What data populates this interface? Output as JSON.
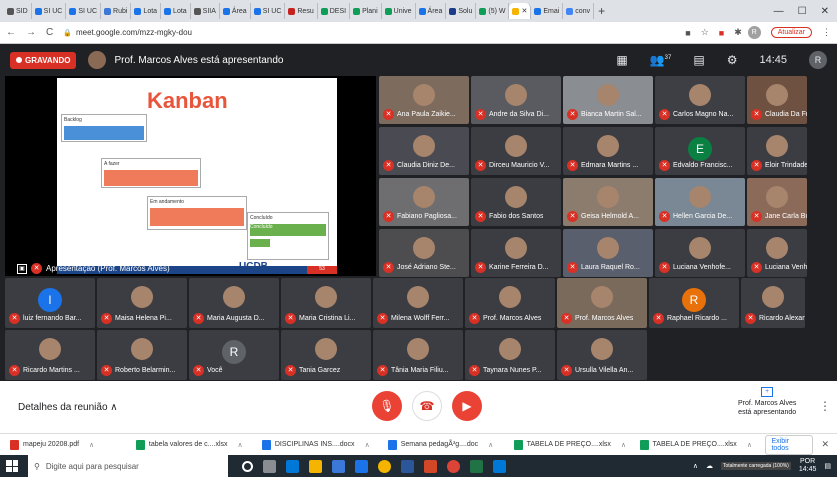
{
  "browser": {
    "tabs": [
      {
        "label": "SID",
        "color": "#555555"
      },
      {
        "label": "SI UC",
        "color": "#1a73e8"
      },
      {
        "label": "SI UC",
        "color": "#1a73e8"
      },
      {
        "label": "Rubi",
        "color": "#3c78d8"
      },
      {
        "label": "Lota",
        "color": "#1a73e8"
      },
      {
        "label": "Lota",
        "color": "#1a73e8"
      },
      {
        "label": "SIIA",
        "color": "#555555"
      },
      {
        "label": "Área",
        "color": "#1a73e8"
      },
      {
        "label": "SI UC",
        "color": "#1a73e8"
      },
      {
        "label": "Resu",
        "color": "#c5221f"
      },
      {
        "label": "DESI",
        "color": "#0f9d58"
      },
      {
        "label": "Plani",
        "color": "#0f9d58"
      },
      {
        "label": "Unive",
        "color": "#0f9d58"
      },
      {
        "label": "Área",
        "color": "#1a73e8"
      },
      {
        "label": "Solu",
        "color": "#1a3c8b"
      },
      {
        "label": "(5) W",
        "color": "#0f9d58"
      },
      {
        "label": "",
        "color": "#f4b400",
        "active": true
      },
      {
        "label": "Emai",
        "color": "#1a73e8"
      },
      {
        "label": "conv",
        "color": "#4285f4"
      }
    ],
    "new_tab": "+",
    "url": "meet.google.com/mzz-mgky-dou",
    "update_label": "Atualizar",
    "profile_initial": "R"
  },
  "meet": {
    "recording_label": "GRAVANDO",
    "presenter_title": "Prof. Marcos Alves está apresentando",
    "clock": "14:45",
    "participant_count": "37",
    "me_label": "Você",
    "me_initial": "R",
    "stage_label": "Apresentação (Prof. Marcos Alves)",
    "stage_sublabel": "Prof. Marcos Alves",
    "slide": {
      "title": "Kanban",
      "cards": [
        "Backlog",
        "A fazer",
        "Em andamento",
        "Concluído",
        "Concluído"
      ],
      "logo": "UCDB",
      "slide_number": "53"
    },
    "participants": [
      {
        "name": "Ana Paula Zaikie...",
        "color": "#7d6b5d"
      },
      {
        "name": "Andre da Silva Di...",
        "color": "#5a5b60"
      },
      {
        "name": "Bianca Martin Sal...",
        "color": "#8a8d92"
      },
      {
        "name": "Carlos Magno Na...",
        "color": "#3e3f44"
      },
      {
        "name": "Claudia Da Frei...",
        "color": "#6f5142"
      },
      {
        "name": "Claudia Diniz De...",
        "color": "#4a4b52"
      },
      {
        "name": "Dirceu Mauricio V...",
        "color": "#3c3d42"
      },
      {
        "name": "Edmara Martins ...",
        "color": "#3c3d42"
      },
      {
        "name": "Edvaldo Francisc...",
        "color": "#3c3d42",
        "initial": "E",
        "initial_color": "#0b8043"
      },
      {
        "name": "Eloir Trindade Va...",
        "color": "#3c3d42"
      },
      {
        "name": "Fabiano Pagliosa...",
        "color": "#6e6e70"
      },
      {
        "name": "Fabio dos Santos",
        "color": "#3c3d42"
      },
      {
        "name": "Geisa Helmold A...",
        "color": "#8c7c6e"
      },
      {
        "name": "Hellen Garcia De...",
        "color": "#7a8794"
      },
      {
        "name": "Jane Carla Bubli...",
        "color": "#8c6a5a"
      },
      {
        "name": "José Adriano Ste...",
        "color": "#4d4d50"
      },
      {
        "name": "Karine Ferreira D...",
        "color": "#3c3d42"
      },
      {
        "name": "Laura Raquel Ro...",
        "color": "#5a5f6e"
      },
      {
        "name": "Luciana Venhofe...",
        "color": "#3c3d42"
      },
      {
        "name": "Luciana Venhofe...",
        "color": "#3c3d42"
      },
      {
        "name": "luiz fernando Bar...",
        "color": "#3c3d42",
        "initial": "l",
        "initial_color": "#1a73e8"
      },
      {
        "name": "Maisa Helena Pi...",
        "color": "#3c3d42"
      },
      {
        "name": "Maria Augusta D...",
        "color": "#3c3d42"
      },
      {
        "name": "Maria Cristina Li...",
        "color": "#3c3d42"
      },
      {
        "name": "Milena Wolff Ferr...",
        "color": "#3c3d42"
      },
      {
        "name": "Prof. Marcos Alves",
        "color": "#3c3d42"
      },
      {
        "name": "Prof. Marcos Alves",
        "color": "#7a6a5c"
      },
      {
        "name": "Raphael Ricardo ...",
        "color": "#3c3d42",
        "initial": "R",
        "initial_color": "#e8710a"
      },
      {
        "name": "Ricardo Alexandr...",
        "color": "#3c3d42"
      },
      {
        "name": "Ricardo Martins ...",
        "color": "#3c3d42"
      },
      {
        "name": "Roberto Belarmin...",
        "color": "#3c3d42"
      },
      {
        "name": "Você",
        "color": "#3c3d42",
        "initial": "R",
        "initial_color": "#5f6368"
      },
      {
        "name": "Tania Garcez",
        "color": "#3c3d42"
      },
      {
        "name": "Tânia Maria Filiu...",
        "color": "#3c3d42"
      },
      {
        "name": "Taynara Nunes P...",
        "color": "#3c3d42"
      },
      {
        "name": "Ursulla Vilella An...",
        "color": "#3c3d42"
      }
    ],
    "details_label": "Detalhes da reunião",
    "presenting_label_1": "Prof. Marcos Alves",
    "presenting_label_2": "está apresentando"
  },
  "downloads": {
    "items": [
      {
        "label": "mapeju 20208.pdf",
        "color": "#d93025"
      },
      {
        "label": "tabela valores de c....xlsx",
        "color": "#0f9d58"
      },
      {
        "label": "DISCIPLINAS INS....docx",
        "color": "#1a73e8"
      },
      {
        "label": "Semana pedagÃ³g....doc",
        "color": "#1a73e8"
      },
      {
        "label": "TABELA DE PREÇO....xlsx",
        "color": "#0f9d58"
      },
      {
        "label": "TABELA DE PREÇO....xlsx",
        "color": "#0f9d58"
      }
    ],
    "show_all": "Exibir todos"
  },
  "taskbar": {
    "search_placeholder": "Digite aqui para pesquisar",
    "lang": "POR",
    "time": "14:45",
    "battery_text": "Totalmente carregada (100%)"
  }
}
